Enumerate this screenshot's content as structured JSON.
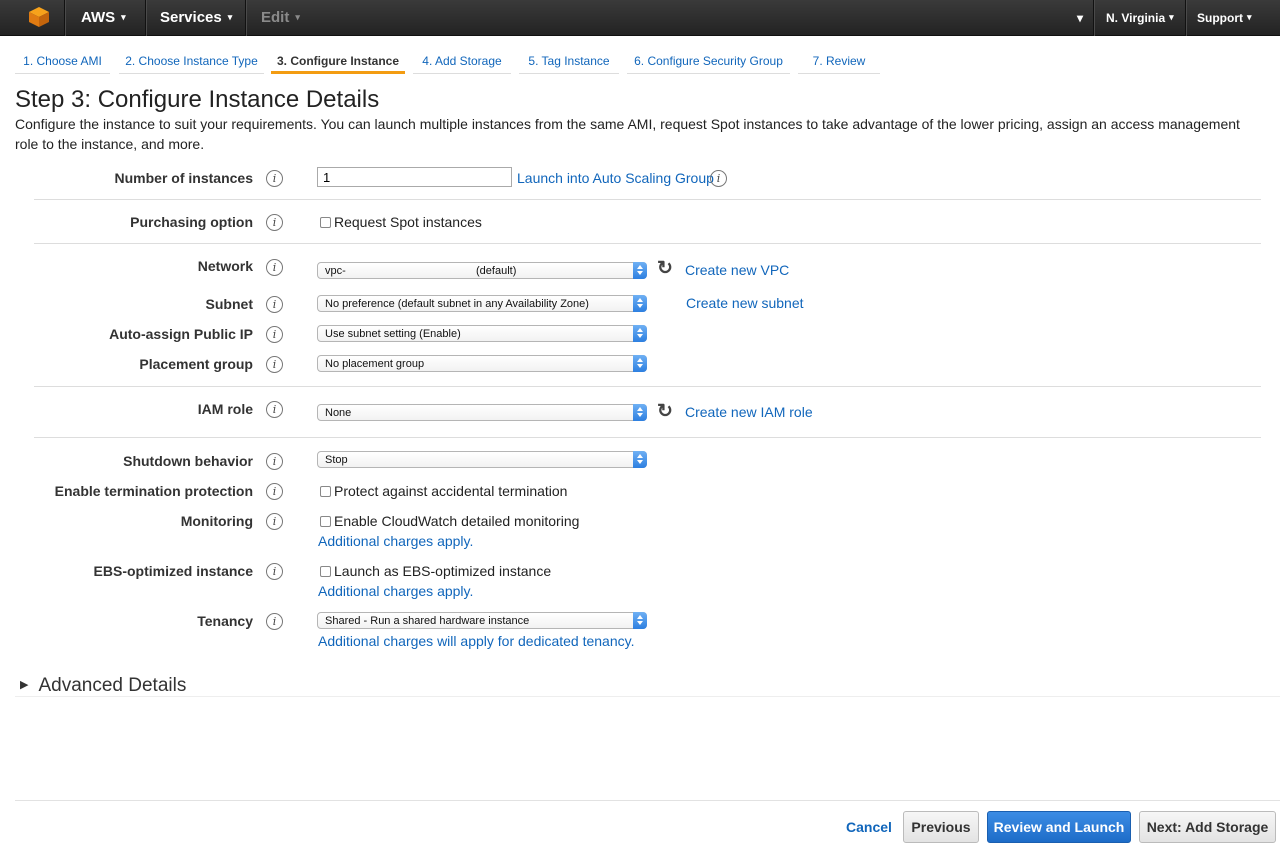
{
  "topbar": {
    "brand": "AWS",
    "services": "Services",
    "edit": "Edit",
    "user_caret": "▾",
    "region": "N. Virginia",
    "support": "Support"
  },
  "tabs": [
    {
      "label": "1. Choose AMI"
    },
    {
      "label": "2. Choose Instance Type"
    },
    {
      "label": "3. Configure Instance"
    },
    {
      "label": "4. Add Storage"
    },
    {
      "label": "5. Tag Instance"
    },
    {
      "label": "6. Configure Security Group"
    },
    {
      "label": "7. Review"
    }
  ],
  "page": {
    "title": "Step 3: Configure Instance Details",
    "description": "Configure the instance to suit your requirements. You can launch multiple instances from the same AMI, request Spot instances to take advantage of the lower pricing, assign an access management role to the instance, and more."
  },
  "form": {
    "instances_label": "Number of instances",
    "instances_value": "1",
    "auto_scaling_link": "Launch into Auto Scaling Group",
    "purchasing_label": "Purchasing option",
    "spot_label": "Request Spot instances",
    "network_label": "Network",
    "network_value": "vpc-",
    "network_default": "(default)",
    "create_vpc": "Create new VPC",
    "subnet_label": "Subnet",
    "subnet_value": "No preference (default subnet in any Availability Zone)",
    "create_subnet": "Create new subnet",
    "public_ip_label": "Auto-assign Public IP",
    "public_ip_value": "Use subnet setting (Enable)",
    "placement_label": "Placement group",
    "placement_value": "No placement group",
    "iam_label": "IAM role",
    "iam_value": "None",
    "create_iam": "Create new IAM role",
    "shutdown_label": "Shutdown behavior",
    "shutdown_value": "Stop",
    "termination_label": "Enable termination protection",
    "termination_check": "Protect against accidental termination",
    "monitoring_label": "Monitoring",
    "monitoring_check": "Enable CloudWatch detailed monitoring",
    "monitoring_charges": "Additional charges apply.",
    "ebs_label": "EBS-optimized instance",
    "ebs_check": "Launch as EBS-optimized instance",
    "ebs_charges": "Additional charges apply.",
    "tenancy_label": "Tenancy",
    "tenancy_value": "Shared - Run a shared hardware instance",
    "tenancy_charges": "Additional charges will apply for dedicated tenancy."
  },
  "advanced": "Advanced Details",
  "info_glyph": "i",
  "footer": {
    "cancel": "Cancel",
    "previous": "Previous",
    "review": "Review and Launch",
    "next": "Next: Add Storage"
  },
  "colors": {
    "link": "#1166bb",
    "active_tab": "#f39c12",
    "primary_button": "#1d6cc8"
  }
}
